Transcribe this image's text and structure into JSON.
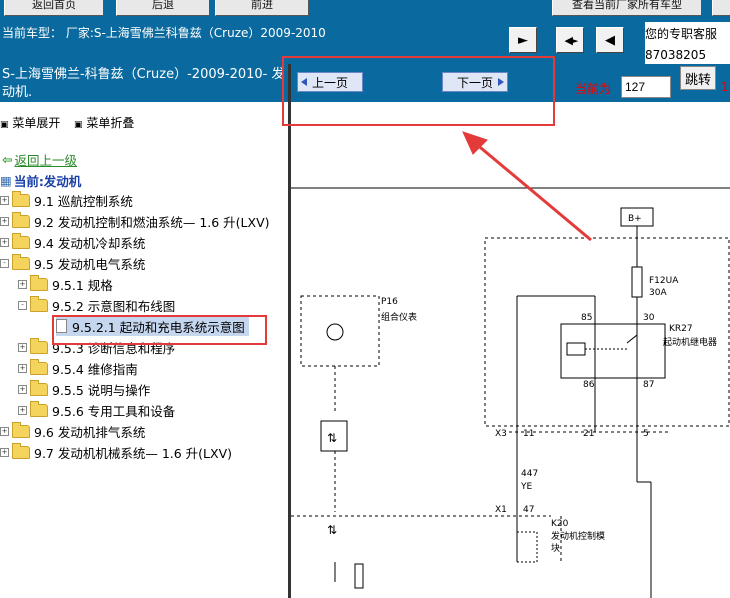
{
  "toolbar": {
    "btn_back_home": "返回首页",
    "btn_back": "后退",
    "btn_forward": "前进",
    "btn_view_vehicle": "查看当前厂家所有车型"
  },
  "infobar": {
    "vehicle_line": "当前车型： 厂家:S-上海雪佛兰科鲁兹（Cruze）2009-2010",
    "service_line1": "您的专职客服",
    "service_line2": "87038205"
  },
  "left": {
    "title": "S-上海雪佛兰-科鲁兹（Cruze）-2009-2010- 发动机.",
    "expand": "菜单展开",
    "collapse": "菜单折叠",
    "back_link": "返回上一级",
    "current": "当前:发动机",
    "tree": [
      {
        "label": "9.1 巡航控制系统"
      },
      {
        "label": "9.2 发动机控制和燃油系统— 1.6 升(LXV)"
      },
      {
        "label": "9.4 发动机冷却系统"
      },
      {
        "label": "9.5 发动机电气系统"
      },
      {
        "label": "9.5.1 规格"
      },
      {
        "label": "9.5.2 示意图和布线图"
      },
      {
        "label": "9.5.2.1 起动和充电系统示意图"
      },
      {
        "label": "9.5.3 诊断信息和程序"
      },
      {
        "label": "9.5.4 维修指南"
      },
      {
        "label": "9.5.5 说明与操作"
      },
      {
        "label": "9.5.6 专用工具和设备"
      },
      {
        "label": "9.6 发动机排气系统"
      },
      {
        "label": "9.7 发动机机械系统— 1.6 升(LXV)"
      }
    ]
  },
  "pager": {
    "prev": "上一页",
    "next": "下一页",
    "current_label": "当前为",
    "page_value": "127",
    "jump": "跳转",
    "cut_text": "12"
  },
  "diagram": {
    "bplus": "B+",
    "fuse_name": "F12UA",
    "fuse_rating": "30A",
    "relay_name": "KR27",
    "relay_desc": "起动机继电器",
    "pin85": "85",
    "pin30": "30",
    "pin86": "86",
    "pin87": "87",
    "p16": "P16",
    "p16_desc": "组合仪表",
    "x3": "X3",
    "x3_11": "11",
    "x3_21": "21",
    "x3_5": "5",
    "wire_num": "447",
    "wire_color": "YE",
    "x1": "X1",
    "x1_47": "47",
    "k20": "K20",
    "k20_desc1": "发动机控制模",
    "k20_desc2": "块"
  }
}
